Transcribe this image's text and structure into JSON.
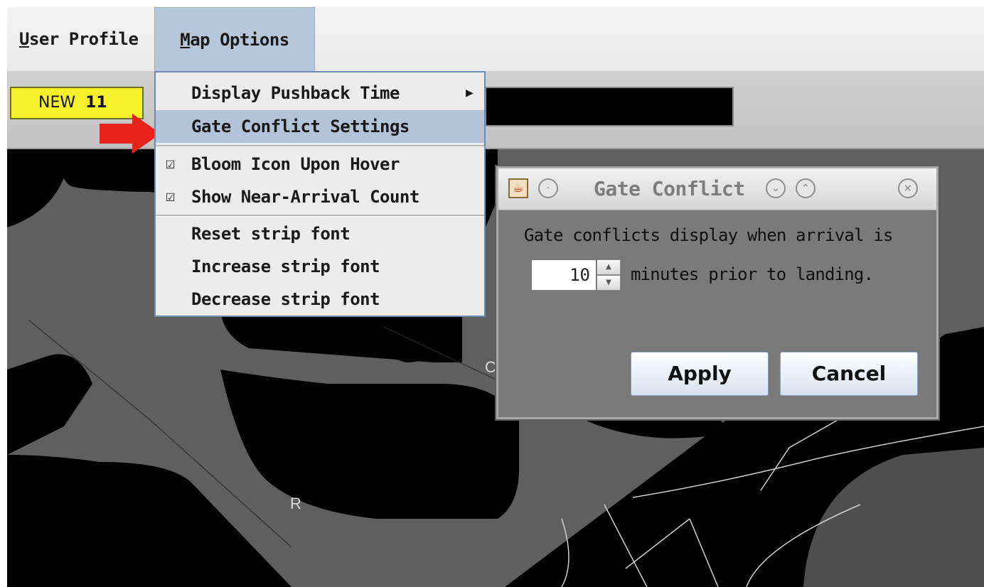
{
  "menubar": {
    "user_profile": {
      "mnemonic": "U",
      "rest": "ser Profile"
    },
    "map_options": {
      "mnemonic": "M",
      "rest": "ap Options"
    }
  },
  "toolbar": {
    "badge_label": "NEW",
    "badge_count": "11"
  },
  "dropdown": {
    "items": [
      {
        "label": "Display Pushback Time",
        "submenu_icon": "triangle-right-icon"
      },
      {
        "label": "Gate Conflict Settings",
        "highlighted": true
      },
      {
        "label": "Bloom Icon Upon Hover",
        "checked": true
      },
      {
        "label": "Show Near-Arrival Count",
        "checked": true
      },
      {
        "label": "Reset strip font"
      },
      {
        "label": "Increase strip font"
      },
      {
        "label": "Decrease strip font"
      }
    ],
    "check_glyph": "☑"
  },
  "map": {
    "labels": [
      "R",
      "C"
    ]
  },
  "dialog": {
    "title": "Gate Conflict",
    "message_line1": "Gate conflicts display when arrival is",
    "spinner_value": "10",
    "message_line2": "minutes prior to landing.",
    "apply_label": "Apply",
    "cancel_label": "Cancel",
    "icons": [
      "java-icon",
      "pin-icon",
      "minimize-icon",
      "maximize-icon",
      "close-icon"
    ]
  },
  "colors": {
    "badge": "#f5f02a",
    "highlight": "#b3c3d8",
    "arrow": "#e8231a"
  }
}
